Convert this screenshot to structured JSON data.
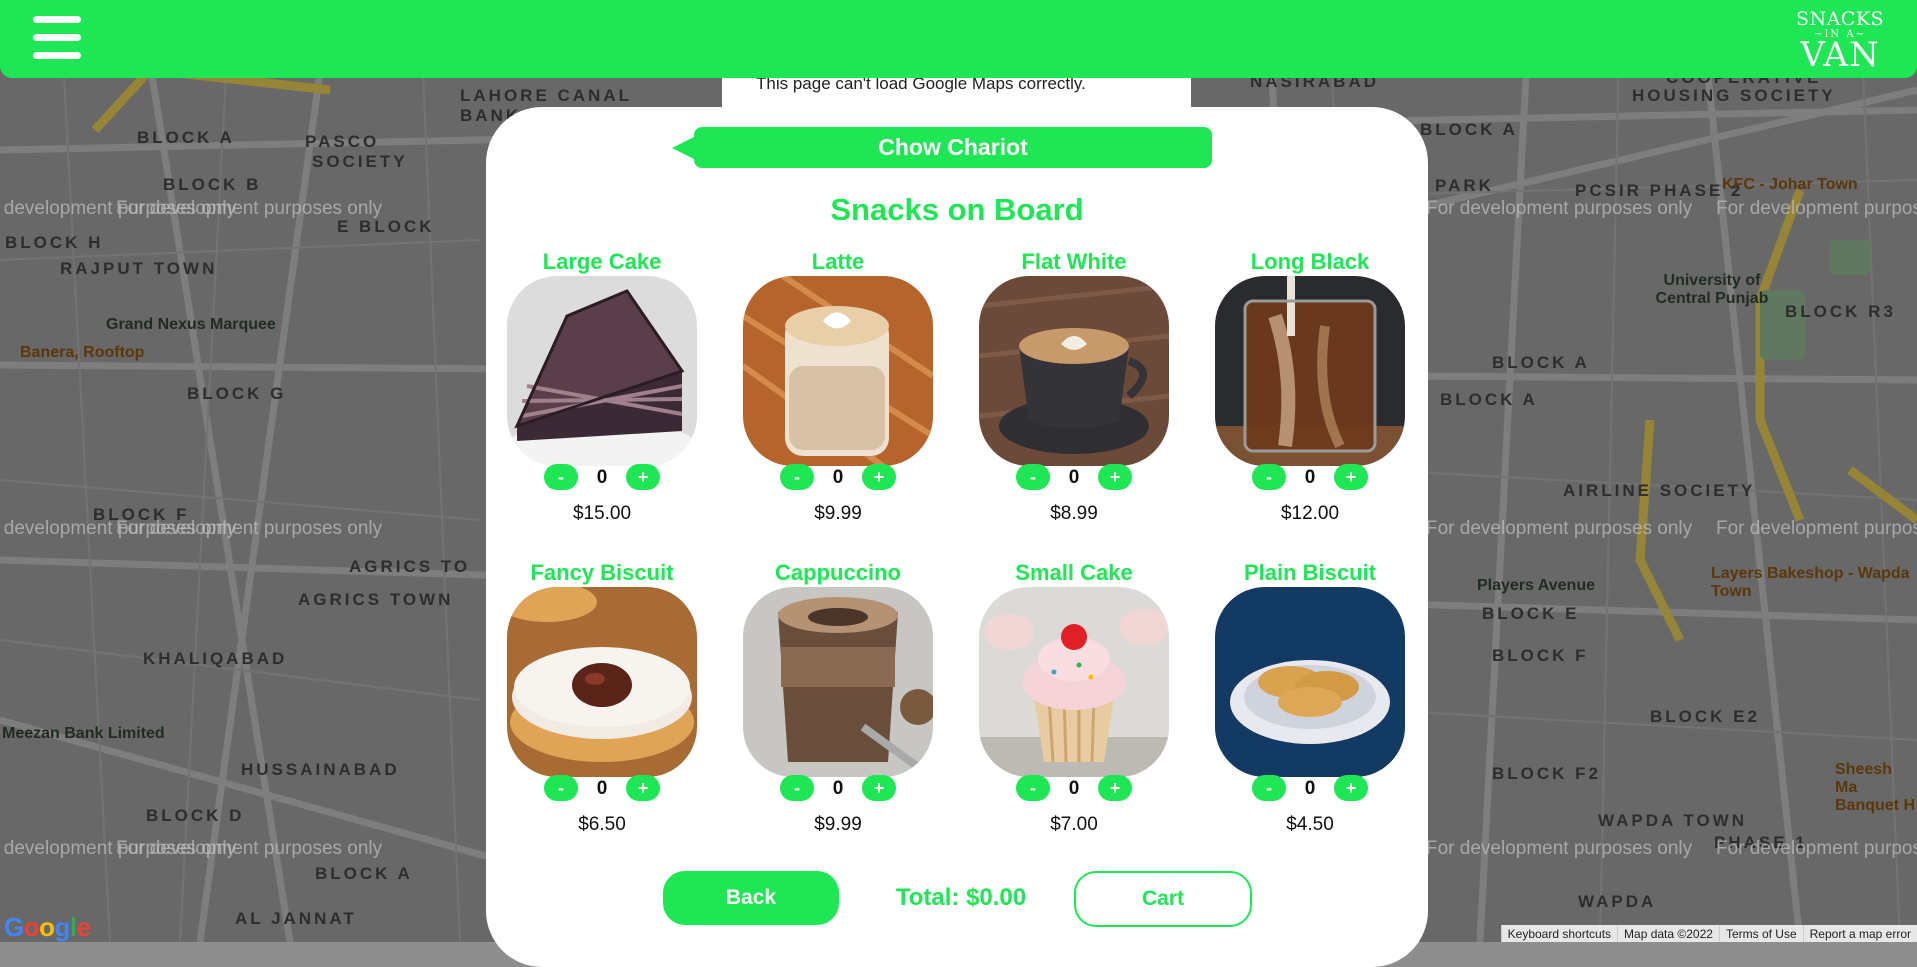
{
  "header": {
    "menu_icon": "hamburger-menu-icon",
    "logo": {
      "line1": "SNACKS",
      "line2": "~IN A~",
      "line3": "VAN"
    }
  },
  "map": {
    "error_text": "This page can't load Google Maps correctly.",
    "watermark": "For development purposes only",
    "areas": [
      "LAHORE CANAL",
      "BANK R",
      "BLOCK A",
      "PASCO",
      "SOCIETY",
      "BLOCK B",
      "E BLOCK",
      "BLOCK H",
      "RAJPUT TOWN",
      "BLOCK G",
      "BLOCK F",
      "AGRICS TO",
      "AGRICS TOWN",
      "KHALIQABAD",
      "HUSSAINABAD",
      "BLOCK D",
      "BLOCK A",
      "AL JANNAT",
      "NASIRABAD",
      "COOPERATIVE",
      "HOUSING SOCIETY",
      "BLOCK A",
      "PARK",
      "PCSIR PHASE 2",
      "BLOCK R3",
      "BLOCK A",
      "BLOCK A",
      "AIRLINE SOCIETY",
      "BLOCK E",
      "BLOCK F",
      "BLOCK E2",
      "BLOCK F2",
      "WAPDA TOWN",
      "PHASE 1",
      "WAPDA"
    ],
    "pois": [
      "Grand Nexus Marquee",
      "Banera, Rooftop",
      "Meezan Bank Limited",
      "University of Central Punjab",
      "KFC - Johar Town",
      "Players Avenue",
      "Layers Bakeshop - Wapda Town",
      "Sheesh Ma Banquet H"
    ],
    "google": "Google",
    "attributions": [
      "Keyboard shortcuts",
      "Map data ©2022",
      "Terms of Use",
      "Report a map error"
    ]
  },
  "van": {
    "name": "Chow Chariot"
  },
  "menu": {
    "title": "Snacks on Board",
    "items": [
      {
        "name": "Large Cake",
        "qty": "0",
        "price": "$15.00",
        "minus": "-",
        "plus": "+"
      },
      {
        "name": "Latte",
        "qty": "0",
        "price": "$9.99",
        "minus": "-",
        "plus": "+"
      },
      {
        "name": "Flat White",
        "qty": "0",
        "price": "$8.99",
        "minus": "-",
        "plus": "+"
      },
      {
        "name": "Long Black",
        "qty": "0",
        "price": "$12.00",
        "minus": "-",
        "plus": "+"
      },
      {
        "name": "Fancy Biscuit",
        "qty": "0",
        "price": "$6.50",
        "minus": "-",
        "plus": "+"
      },
      {
        "name": "Cappuccino",
        "qty": "0",
        "price": "$9.99",
        "minus": "-",
        "plus": "+"
      },
      {
        "name": "Small Cake",
        "qty": "0",
        "price": "$7.00",
        "minus": "-",
        "plus": "+"
      },
      {
        "name": "Plain Biscuit",
        "qty": "0",
        "price": "$4.50",
        "minus": "-",
        "plus": "+"
      }
    ]
  },
  "footer": {
    "back_label": "Back",
    "total": "Total: $0.00",
    "cart_label": "Cart"
  },
  "colors": {
    "accent": "#1ee655",
    "panel": "#ffffff",
    "map": "#8b8b8b"
  }
}
